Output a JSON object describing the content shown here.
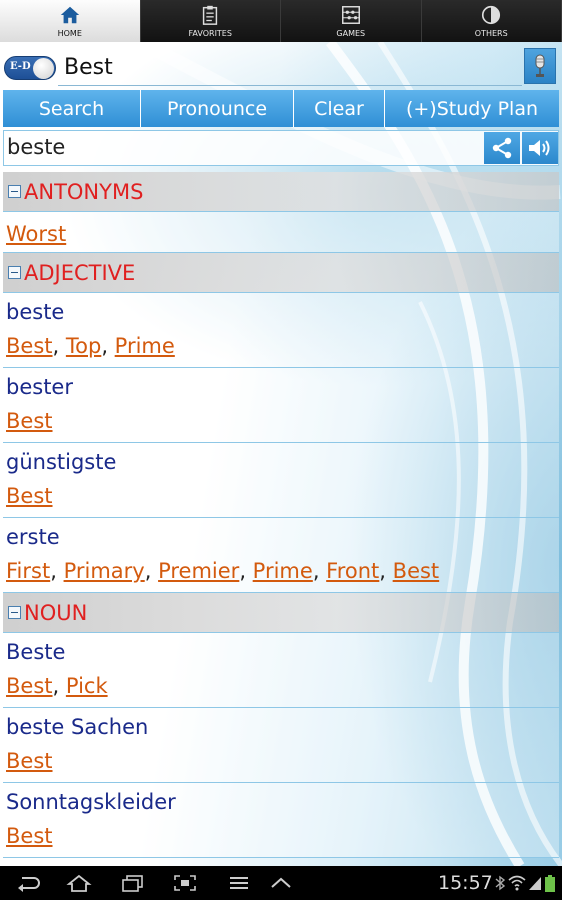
{
  "tabs": [
    {
      "label": "HOME",
      "icon": "home-icon"
    },
    {
      "label": "FAVORITES",
      "icon": "clipboard-icon"
    },
    {
      "label": "GAMES",
      "icon": "abacus-icon"
    },
    {
      "label": "OTHERS",
      "icon": "circle-half-icon"
    }
  ],
  "toggle": {
    "label": "E-D"
  },
  "search": {
    "value": "Best"
  },
  "actions": [
    "Search",
    "Pronounce",
    "Clear",
    "(+)Study Plan"
  ],
  "word": "beste",
  "sections": {
    "antonyms": {
      "title": "ANTONYMS",
      "links": [
        "Worst"
      ]
    },
    "adjective": {
      "title": "ADJECTIVE",
      "entries": [
        {
          "term": "beste",
          "links": [
            "Best",
            "Top",
            "Prime"
          ]
        },
        {
          "term": "bester",
          "links": [
            "Best"
          ]
        },
        {
          "term": "günstigste",
          "links": [
            "Best"
          ]
        },
        {
          "term": "erste",
          "links": [
            "First",
            "Primary",
            "Premier",
            "Prime",
            "Front",
            "Best"
          ]
        }
      ]
    },
    "noun": {
      "title": "NOUN",
      "entries": [
        {
          "term": "Beste",
          "links": [
            "Best",
            "Pick"
          ]
        },
        {
          "term": "beste Sachen",
          "links": [
            "Best"
          ]
        },
        {
          "term": "Sonntagskleider",
          "links": [
            "Best"
          ]
        }
      ]
    }
  },
  "status": {
    "time": "15:57"
  },
  "colors": {
    "accent": "#2f8fd5",
    "section_title": "#e02020",
    "link": "#d35a0e",
    "term": "#1a2a8a"
  }
}
